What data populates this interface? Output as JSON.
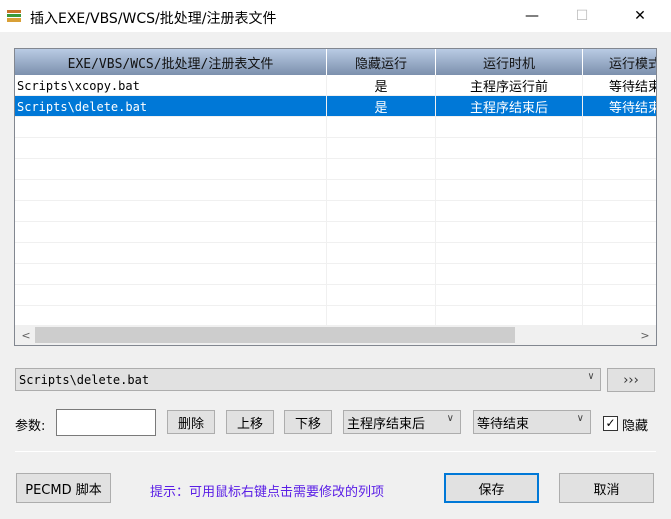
{
  "window": {
    "title": "插入EXE/VBS/WCS/批处理/注册表文件",
    "minimize": "—",
    "maximize": "☐",
    "close": "✕"
  },
  "table": {
    "columns": [
      "EXE/VBS/WCS/批处理/注册表文件",
      "隐藏运行",
      "运行时机",
      "运行模式"
    ],
    "rows": [
      {
        "file": "Scripts\\xcopy.bat",
        "hidden": "是",
        "timing": "主程序运行前",
        "mode": "等待结束",
        "selected": false
      },
      {
        "file": "Scripts\\delete.bat",
        "hidden": "是",
        "timing": "主程序结束后",
        "mode": "等待结束",
        "selected": true
      }
    ]
  },
  "file_combo": {
    "value": "Scripts\\delete.bat"
  },
  "browse_button": "›››",
  "params": {
    "label": "参数:",
    "value": ""
  },
  "buttons": {
    "delete": "删除",
    "up": "上移",
    "down": "下移",
    "pecmd": "PECMD 脚本",
    "save": "保存",
    "cancel": "取消"
  },
  "timing_combo": {
    "value": "主程序结束后"
  },
  "mode_combo": {
    "value": "等待结束"
  },
  "hide_checkbox": {
    "label": "隐藏",
    "checked": true
  },
  "hint": "提示：可用鼠标右键点击需要修改的列项",
  "colors": {
    "selection": "#0078d7",
    "hint": "#5a1ee6",
    "accent": "#0078d7"
  }
}
